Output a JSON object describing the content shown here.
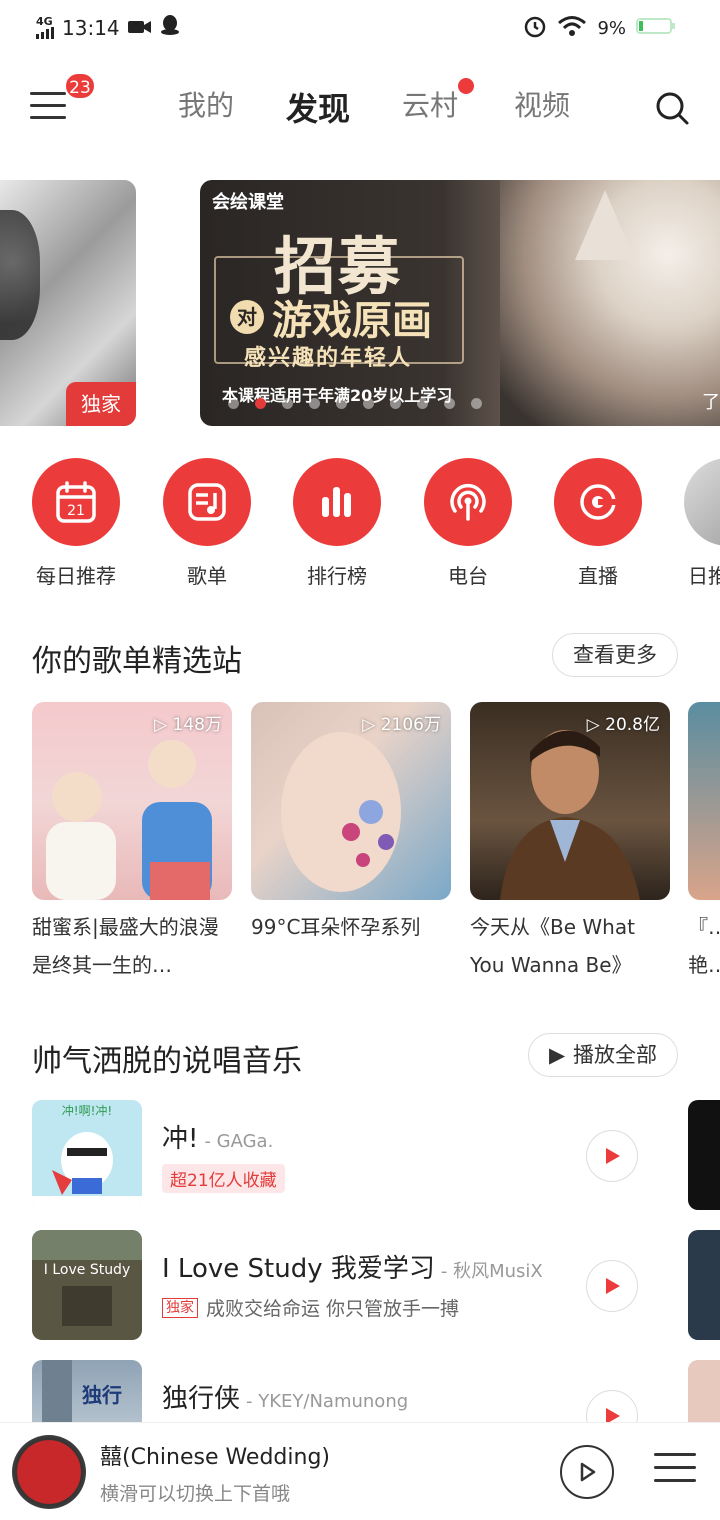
{
  "status_bar": {
    "network": "4G",
    "time": "13:14",
    "battery": "9%"
  },
  "top_nav": {
    "menu_badge": "23",
    "tabs": [
      {
        "label": "我的",
        "active": false
      },
      {
        "label": "发现",
        "active": true
      },
      {
        "label": "云村",
        "active": false,
        "dot": true
      },
      {
        "label": "视频",
        "active": false
      }
    ]
  },
  "banner": {
    "prev_tag": "独家",
    "brand": "会绘课堂",
    "title": "招募",
    "dui": "对",
    "subtitle": "游戏原画",
    "subtitle2": "感兴趣的年轻人",
    "note": "本课程适用于年满20岁以上学习",
    "more": "了"
  },
  "quick_icons": [
    {
      "label": "每日推荐",
      "icon": "calendar-icon",
      "day": "21"
    },
    {
      "label": "歌单",
      "icon": "playlist-icon"
    },
    {
      "label": "排行榜",
      "icon": "chart-icon"
    },
    {
      "label": "电台",
      "icon": "radio-icon"
    },
    {
      "label": "直播",
      "icon": "live-icon"
    },
    {
      "label": "日推",
      "icon": "partial-icon"
    }
  ],
  "playlist_section": {
    "title": "你的歌单精选站",
    "more_label": "查看更多",
    "cards": [
      {
        "title": "甜蜜系|最盛大的浪漫是终其一生的…",
        "plays": "148万"
      },
      {
        "title": "99°C耳朵怀孕系列",
        "plays": "2106万"
      },
      {
        "title": "今天从《Be What You Wanna Be》听…",
        "plays": "20.8亿"
      },
      {
        "title": "『…艳…",
        "plays": ""
      }
    ]
  },
  "rap_section": {
    "title": "帅气洒脱的说唱音乐",
    "play_all_label": "播放全部",
    "songs": [
      {
        "title": "冲!",
        "artist": "- GAGa.",
        "tag": "超21亿人收藏",
        "tag_type": "red",
        "cover_text": "冲!啊!冲!"
      },
      {
        "title": "I Love Study 我爱学习",
        "artist": "- 秋风MusiX",
        "tag": "独家",
        "tag_type": "box",
        "desc": "成败交给命运 你只管放手一搏",
        "cover_text": "I Love Study"
      },
      {
        "title": "独行侠",
        "artist": "- YKEY/Namunong",
        "tag": "",
        "tag_type": "",
        "cover_text": "独行"
      }
    ]
  },
  "player": {
    "title": "囍(Chinese Wedding)",
    "subtitle": "横滑可以切换上下首哦"
  },
  "colors": {
    "accent": "#ec3b3b",
    "text": "#222222",
    "muted": "#888888"
  }
}
